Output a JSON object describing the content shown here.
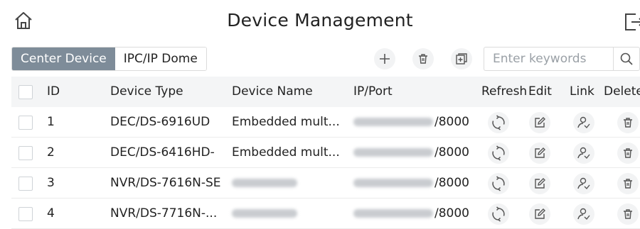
{
  "header": {
    "title": "Device Management",
    "home_icon": "home-icon",
    "exit_icon": "exit-icon"
  },
  "toolbar": {
    "tabs": [
      {
        "label": "Center Device",
        "active": true
      },
      {
        "label": "IPC/IP Dome",
        "active": false
      }
    ],
    "add_icon": "plus-icon",
    "delete_icon": "trash-icon",
    "batch_icon": "add-box-icon",
    "search": {
      "placeholder": "Enter keywords",
      "value": ""
    },
    "search_icon": "search-icon",
    "accent_color": "#7e8c99"
  },
  "table": {
    "columns": [
      "ID",
      "Device Type",
      "Device Name",
      "IP/Port",
      "Refresh",
      "Edit",
      "Link",
      "Delete"
    ],
    "rows": [
      {
        "id": "1",
        "type": "DEC/DS-6916UD",
        "name": "Embedded mult...",
        "port": "/8000"
      },
      {
        "id": "2",
        "type": "DEC/DS-6416HD-",
        "name": "Embedded mult...",
        "port": "/8000"
      },
      {
        "id": "3",
        "type": "NVR/DS-7616N-SE",
        "name": "",
        "port": "/8000"
      },
      {
        "id": "4",
        "type": "NVR/DS-7716N-...",
        "name": "",
        "port": "/8000"
      }
    ],
    "row_icons": [
      "refresh-icon",
      "edit-icon",
      "link-user-icon",
      "trash-icon"
    ]
  }
}
